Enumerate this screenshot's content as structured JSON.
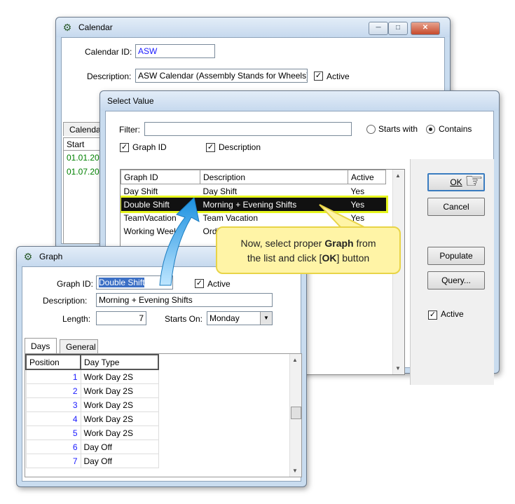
{
  "calendar": {
    "title": "Calendar",
    "id_label": "Calendar ID:",
    "id_value": "ASW",
    "desc_label": "Description:",
    "desc_value": "ASW Calendar (Assembly Stands for Wheels)",
    "active_label": "Active",
    "tab_label": "Calendar",
    "col_start": "Start",
    "rows": [
      "01.01.20",
      "01.07.20"
    ],
    "row_color": "#008000"
  },
  "select": {
    "title": "Select Value",
    "filter_label": "Filter:",
    "filter_value": "",
    "starts_with_label": "Starts with",
    "contains_label": "Contains",
    "graph_id_check_label": "Graph ID",
    "description_check_label": "Description",
    "columns": [
      "Graph ID",
      "Description",
      "Active"
    ],
    "rows": [
      {
        "id": "Day Shift",
        "desc": "Day Shift",
        "active": "Yes"
      },
      {
        "id": "Double Shift",
        "desc": "Morning + Evening Shifts",
        "active": "Yes"
      },
      {
        "id": "TeamVacation",
        "desc": "Team Vacation",
        "active": "Yes"
      },
      {
        "id": "Working Week",
        "desc": "Ordi",
        "active": ""
      }
    ],
    "selected_index": 1,
    "ok_label": "OK",
    "cancel_label": "Cancel",
    "populate_label": "Populate",
    "query_label": "Query...",
    "active_label": "Active",
    "highlight_color": "#e6f51e"
  },
  "graph": {
    "title": "Graph",
    "id_label": "Graph ID:",
    "id_value": "Double Shift",
    "active_label": "Active",
    "desc_label": "Description:",
    "desc_value": "Morning + Evening Shifts",
    "length_label": "Length:",
    "length_value": "7",
    "starts_on_label": "Starts On:",
    "starts_on_value": "Monday",
    "tabs": [
      "Days",
      "General"
    ],
    "col_position": "Position",
    "col_daytype": "Day Type",
    "rows": [
      {
        "pos": "1",
        "type": "Work Day 2S"
      },
      {
        "pos": "2",
        "type": "Work Day 2S"
      },
      {
        "pos": "3",
        "type": "Work Day 2S"
      },
      {
        "pos": "4",
        "type": "Work Day 2S"
      },
      {
        "pos": "5",
        "type": "Work Day 2S"
      },
      {
        "pos": "6",
        "type": "Day Off"
      },
      {
        "pos": "7",
        "type": "Day Off"
      }
    ],
    "pos_color": "#1a1aff"
  },
  "callout": {
    "line1_pre": "Now, select proper ",
    "line1_bold": "Graph",
    "line1_post": " from",
    "line2_pre": "the list and click [",
    "line2_bold": "OK",
    "line2_post": "] button"
  },
  "icons": {
    "app": "gear-icon",
    "pointer": "hand-pointer-icon",
    "arrow": "curved-arrow-icon",
    "minimize": "minimize-icon",
    "maximize": "maximize-icon",
    "close": "close-icon"
  }
}
